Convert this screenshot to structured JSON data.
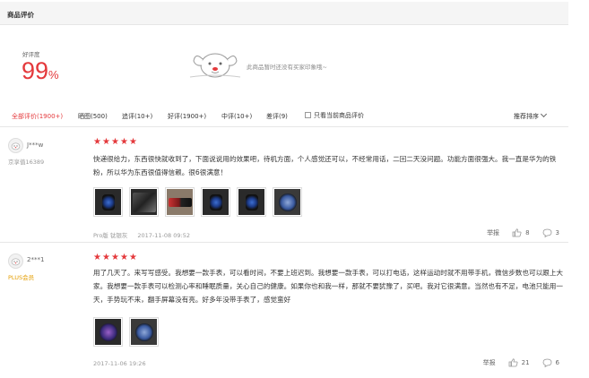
{
  "header": {
    "title": "商品评价"
  },
  "summary": {
    "rate_label": "好评度",
    "rate_number": "99",
    "rate_unit": "%",
    "no_impression": "此商品暂时还没有买家印象哦~"
  },
  "filters": [
    {
      "label": "全部评价(1900+)",
      "active": true
    },
    {
      "label": "晒图(500)",
      "active": false
    },
    {
      "label": "追评(10+)",
      "active": false
    },
    {
      "label": "好评(1900+)",
      "active": false
    },
    {
      "label": "中评(10+)",
      "active": false
    },
    {
      "label": "差评(9)",
      "active": false
    }
  ],
  "filter_check_label": "只看当前商品评价",
  "sort_label": "推荐排序",
  "stars_color": "#e4393c",
  "reviews": [
    {
      "user": "J***w",
      "level": "京享值16389",
      "rating": 5,
      "text": "快递很给力，东西很快就收到了，下面说说用的效果吧，待机方面，个人感觉还可以，不经常用话，二回二天没问题。功能方面很强大。我一直是华为的铁粉，所以华为东西很值得信赖。很6很满意！",
      "image_count": 6,
      "product_variant": "Pro版 钛银灰",
      "date": "2017-11-08 09:52",
      "report_label": "举报",
      "likes": "8",
      "replies": "3"
    },
    {
      "user": "2***1",
      "level": "PLUS会员",
      "rating": 5,
      "text": "用了几天了。来写写感受。我想要一款手表，可以看时间，不要上班迟到。我想要一款手表，可以打电话，这样运动时就不用带手机，微信步数也可以跟上大家。我想要一款手表可以检测心率和睡眠质量，关心自己的健康。如果你也和我一样，那就不要犹豫了，买吧。我对它很满意。当然也有不足，电池只能用一天，手势玩不来，翻手屏幕没有亮。好多年没带手表了，感觉蛮好",
      "image_count": 2,
      "product_variant": "",
      "date": "2017-11-06 19:26",
      "report_label": "举报",
      "likes": "21",
      "replies": "6"
    }
  ]
}
